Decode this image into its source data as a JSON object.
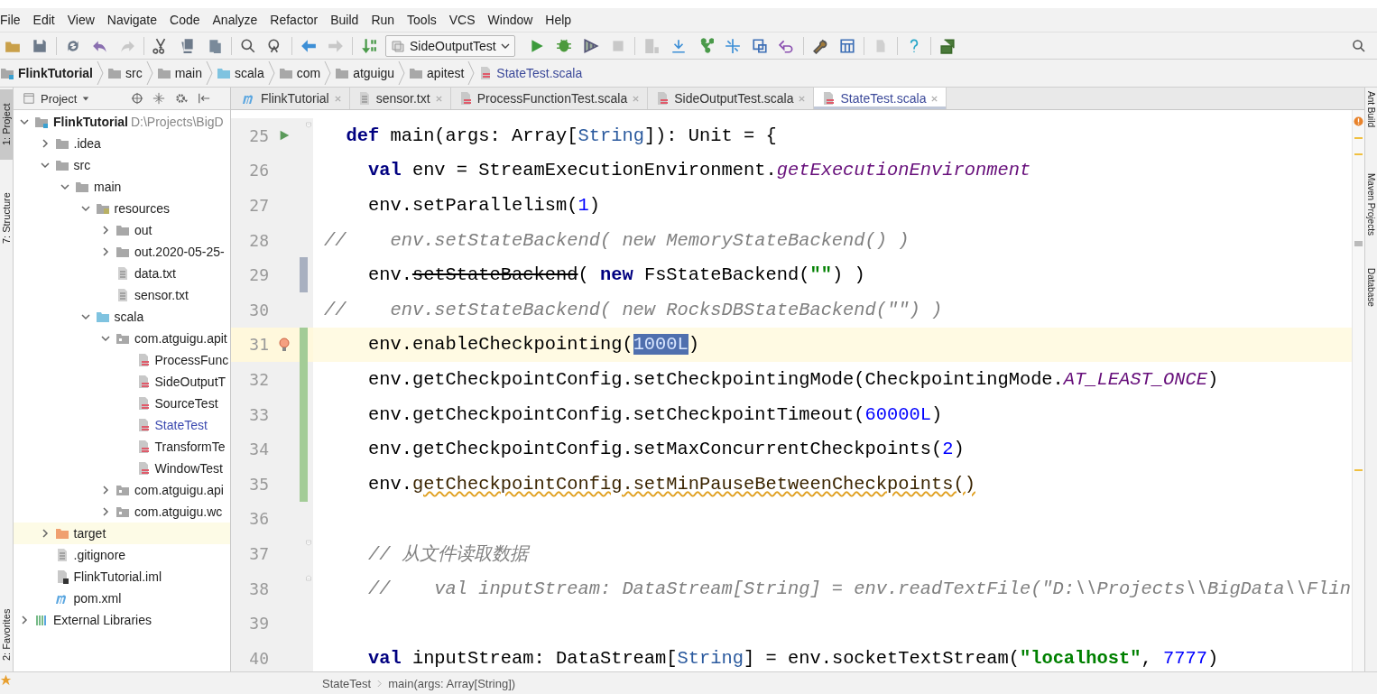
{
  "menu": [
    "File",
    "Edit",
    "View",
    "Navigate",
    "Code",
    "Analyze",
    "Refactor",
    "Build",
    "Run",
    "Tools",
    "VCS",
    "Window",
    "Help"
  ],
  "toolbar": {
    "run_configuration": "SideOutputTest"
  },
  "breadcrumbs": [
    {
      "label": "FlinkTutorial",
      "kind": "project"
    },
    {
      "label": "src",
      "kind": "folder"
    },
    {
      "label": "main",
      "kind": "folder"
    },
    {
      "label": "scala",
      "kind": "source-folder"
    },
    {
      "label": "com",
      "kind": "package"
    },
    {
      "label": "atguigu",
      "kind": "package"
    },
    {
      "label": "apitest",
      "kind": "package"
    },
    {
      "label": "StateTest.scala",
      "kind": "scala-file"
    }
  ],
  "left_tool_tabs": [
    {
      "label": "1: Project",
      "selected": true
    },
    {
      "label": "7: Structure",
      "selected": false
    },
    {
      "label": "2: Favorites",
      "selected": false
    }
  ],
  "right_tool_tabs": [
    "Ant Build",
    "Maven Projects",
    "Database"
  ],
  "project": {
    "title": "Project",
    "tree": [
      {
        "label": "FlinkTutorial",
        "kind": "project",
        "path": "D:\\Projects\\BigD",
        "expanded": true,
        "children": [
          {
            "label": ".idea",
            "kind": "folder",
            "expanded": false
          },
          {
            "label": "src",
            "kind": "folder",
            "expanded": true,
            "children": [
              {
                "label": "main",
                "kind": "folder",
                "expanded": true,
                "children": [
                  {
                    "label": "resources",
                    "kind": "resource-folder",
                    "expanded": true,
                    "children": [
                      {
                        "label": "out",
                        "kind": "folder",
                        "expanded": false
                      },
                      {
                        "label": "out.2020-05-25-",
                        "kind": "folder",
                        "expanded": false
                      },
                      {
                        "label": "data.txt",
                        "kind": "text-file"
                      },
                      {
                        "label": "sensor.txt",
                        "kind": "text-file"
                      }
                    ]
                  },
                  {
                    "label": "scala",
                    "kind": "source-folder",
                    "expanded": true,
                    "children": [
                      {
                        "label": "com.atguigu.apit",
                        "kind": "package",
                        "expanded": true,
                        "children": [
                          {
                            "label": "ProcessFunc",
                            "kind": "scala-file",
                            "modified": false
                          },
                          {
                            "label": "SideOutputT",
                            "kind": "scala-file",
                            "modified": false
                          },
                          {
                            "label": "SourceTest",
                            "kind": "scala-file",
                            "modified": false
                          },
                          {
                            "label": "StateTest",
                            "kind": "scala-file",
                            "modified": true
                          },
                          {
                            "label": "TransformTe",
                            "kind": "scala-file",
                            "modified": false
                          },
                          {
                            "label": "WindowTest",
                            "kind": "scala-file",
                            "modified": false
                          }
                        ]
                      },
                      {
                        "label": "com.atguigu.api",
                        "kind": "package",
                        "expanded": false
                      },
                      {
                        "label": "com.atguigu.wc",
                        "kind": "package",
                        "expanded": false
                      }
                    ]
                  }
                ]
              }
            ]
          },
          {
            "label": "target",
            "kind": "excluded-folder",
            "expanded": false
          },
          {
            "label": ".gitignore",
            "kind": "text-file"
          },
          {
            "label": "FlinkTutorial.iml",
            "kind": "iml-file"
          },
          {
            "label": "pom.xml",
            "kind": "maven-file"
          }
        ]
      },
      {
        "label": "External Libraries",
        "kind": "libraries",
        "expanded": false
      }
    ]
  },
  "editor_tabs": [
    {
      "label": "FlinkTutorial",
      "kind": "maven-file",
      "selected": false
    },
    {
      "label": "sensor.txt",
      "kind": "text-file",
      "selected": false
    },
    {
      "label": "ProcessFunctionTest.scala",
      "kind": "scala-file",
      "selected": false
    },
    {
      "label": "SideOutputTest.scala",
      "kind": "scala-file",
      "selected": false
    },
    {
      "label": "StateTest.scala",
      "kind": "scala-file",
      "selected": true
    }
  ],
  "code": [
    {
      "number": "25",
      "current": false,
      "modified": false,
      "added": false,
      "gutter": [
        {
          "kind": "run"
        },
        {
          "kind": "fold-start"
        }
      ],
      "tokens": [
        {
          "t": "  def",
          "kind": "keyword"
        },
        {
          "t": " main(args: Array[",
          "kind": "plain"
        },
        {
          "t": "String",
          "kind": "type"
        },
        {
          "t": "]): Unit = {",
          "kind": "plain"
        }
      ]
    },
    {
      "number": "26",
      "current": false,
      "modified": false,
      "added": false,
      "tokens": [
        {
          "t": "    val",
          "kind": "keyword"
        },
        {
          "t": " env = StreamExecutionEnvironment.",
          "kind": "plain"
        },
        {
          "t": "getExecutionEnvironment",
          "kind": "static"
        }
      ]
    },
    {
      "number": "27",
      "current": false,
      "modified": false,
      "added": false,
      "tokens": [
        {
          "t": "    env.setParallelism(",
          "kind": "plain"
        },
        {
          "t": "1",
          "kind": "number"
        },
        {
          "t": ")",
          "kind": "plain"
        }
      ]
    },
    {
      "number": "28",
      "current": false,
      "modified": false,
      "added": false,
      "tokens": [
        {
          "t": "//    env.setStateBackend( new MemoryStateBackend() )",
          "kind": "comment"
        }
      ]
    },
    {
      "number": "29",
      "current": false,
      "modified": true,
      "added": false,
      "tokens": [
        {
          "t": "    env.",
          "kind": "plain"
        },
        {
          "t": "setStateBackend",
          "kind": "deprecated"
        },
        {
          "t": "( ",
          "kind": "plain"
        },
        {
          "t": "new",
          "kind": "keyword"
        },
        {
          "t": " FsStateBackend(",
          "kind": "plain"
        },
        {
          "t": "\"\"",
          "kind": "string"
        },
        {
          "t": ") )",
          "kind": "plain"
        }
      ]
    },
    {
      "number": "30",
      "current": false,
      "modified": false,
      "added": false,
      "tokens": [
        {
          "t": "//    env.setStateBackend( new RocksDBStateBackend(\"\") )",
          "kind": "comment"
        }
      ]
    },
    {
      "number": "31",
      "current": true,
      "modified": false,
      "added": true,
      "gutter": [
        {
          "kind": "bulb"
        }
      ],
      "tokens": [
        {
          "t": "    env.enableCheckpointing(",
          "kind": "plain"
        },
        {
          "t": "1000L",
          "kind": "selection"
        },
        {
          "t": ")",
          "kind": "plain"
        }
      ]
    },
    {
      "number": "32",
      "current": false,
      "modified": false,
      "added": true,
      "tokens": [
        {
          "t": "    env.getCheckpointConfig.setCheckpointingMode(CheckpointingMode.",
          "kind": "plain"
        },
        {
          "t": "AT_LEAST_ONCE",
          "kind": "static"
        },
        {
          "t": ")",
          "kind": "plain"
        }
      ]
    },
    {
      "number": "33",
      "current": false,
      "modified": false,
      "added": true,
      "tokens": [
        {
          "t": "    env.getCheckpointConfig.setCheckpointTimeout(",
          "kind": "plain"
        },
        {
          "t": "60000L",
          "kind": "number"
        },
        {
          "t": ")",
          "kind": "plain"
        }
      ]
    },
    {
      "number": "34",
      "current": false,
      "modified": false,
      "added": true,
      "tokens": [
        {
          "t": "    env.getCheckpointConfig.setMaxConcurrentCheckpoints(",
          "kind": "plain"
        },
        {
          "t": "2",
          "kind": "number"
        },
        {
          "t": ")",
          "kind": "plain"
        }
      ]
    },
    {
      "number": "35",
      "current": false,
      "modified": false,
      "added": true,
      "tokens": [
        {
          "t": "    env.",
          "kind": "plain"
        },
        {
          "t": "getCheckpointConfig.setMinPauseBetweenCheckpoints()",
          "kind": "error"
        }
      ]
    },
    {
      "number": "36",
      "current": false,
      "modified": false,
      "added": false
    },
    {
      "number": "37",
      "current": false,
      "modified": false,
      "added": false,
      "gutter": [
        {
          "kind": "fold-start"
        }
      ],
      "tokens": [
        {
          "t": "    // 从文件读取数据",
          "kind": "comment"
        }
      ]
    },
    {
      "number": "38",
      "current": false,
      "modified": false,
      "added": false,
      "gutter": [
        {
          "kind": "fold-end"
        }
      ],
      "tokens": [
        {
          "t": "    //    val inputStream: DataStream[String] = env.readTextFile(\"D:\\\\Projects\\\\BigData\\\\Flin",
          "kind": "comment"
        }
      ]
    },
    {
      "number": "39",
      "current": false,
      "modified": false,
      "added": false
    },
    {
      "number": "40",
      "current": false,
      "modified": false,
      "added": false,
      "tokens": [
        {
          "t": "    val",
          "kind": "keyword"
        },
        {
          "t": " inputStream: DataStream[",
          "kind": "plain"
        },
        {
          "t": "String",
          "kind": "type"
        },
        {
          "t": "] = env.socketTextStream(",
          "kind": "plain"
        },
        {
          "t": "\"localhost\"",
          "kind": "string"
        },
        {
          "t": ", ",
          "kind": "plain"
        },
        {
          "t": "7777",
          "kind": "number"
        },
        {
          "t": ")",
          "kind": "plain"
        }
      ]
    }
  ],
  "status_breadcrumbs": [
    "StateTest",
    "main(args: Array[String])"
  ]
}
